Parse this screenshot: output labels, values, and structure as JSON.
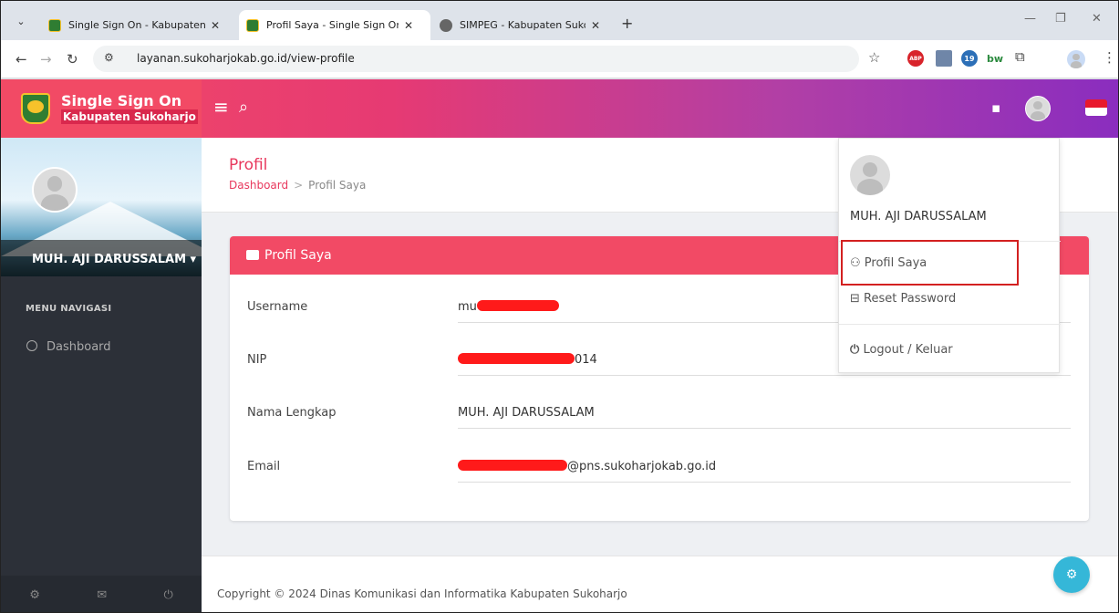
{
  "browser": {
    "tabs": [
      {
        "title": "Single Sign On - Kabupaten Sukoharjo",
        "active": false
      },
      {
        "title": "Profil Saya - Single Sign On - Kabupaten Sukoharjo",
        "active": true
      },
      {
        "title": "SIMPEG - Kabupaten Sukoharjo",
        "active": false
      }
    ],
    "url": "layanan.sukoharjokab.go.id/view-profile",
    "extension_badges": {
      "abp": "ABP",
      "count": "19",
      "bw": "bw"
    }
  },
  "app": {
    "brand_title": "Single Sign On",
    "brand_subtitle": "Kabupaten Sukoharjo",
    "colors": {
      "primary": "#f24a65",
      "gradient_end": "#8a2dbf",
      "sidebar": "#2c3038",
      "fab": "#35b7d8",
      "highlight": "#d32020"
    }
  },
  "sidebar": {
    "user_name": "MUH. AJI DARUSSALAM",
    "menu_header": "MENU NAVIGASI",
    "items": [
      {
        "label": "Dashboard",
        "icon": "dashboard-icon"
      }
    ],
    "footer_icons": [
      "settings-icon",
      "mail-icon",
      "power-icon"
    ]
  },
  "page": {
    "title": "Profil",
    "breadcrumb": {
      "home": "Dashboard",
      "separator": ">",
      "current": "Profil Saya"
    }
  },
  "profile_card": {
    "title": "Profil Saya",
    "fields": [
      {
        "label": "Username",
        "prefix": "mu",
        "suffix": ""
      },
      {
        "label": "NIP",
        "prefix": "",
        "suffix": "014"
      },
      {
        "label": "Nama Lengkap",
        "prefix": "MUH. AJI DARUSSALAM",
        "suffix": ""
      },
      {
        "label": "Email",
        "prefix": "",
        "suffix": "@pns.sukoharjokab.go.id"
      }
    ]
  },
  "user_menu": {
    "name": "MUH. AJI DARUSSALAM",
    "items": [
      {
        "label": "Profil Saya",
        "icon": "user-icon"
      },
      {
        "label": "Reset Password",
        "icon": "reset-icon"
      },
      {
        "label": "Logout / Keluar",
        "icon": "power-icon"
      }
    ]
  },
  "footer": {
    "copyright": "Copyright © 2024 Dinas Komunikasi dan Informatika Kabupaten Sukoharjo"
  }
}
